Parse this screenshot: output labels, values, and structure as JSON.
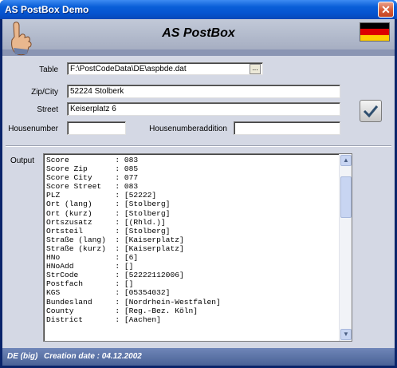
{
  "window": {
    "title": "AS PostBox Demo",
    "close_glyph": "✕"
  },
  "header": {
    "app_title": "AS PostBox",
    "flag_colors": [
      "#000000",
      "#dd0000",
      "#ffce00"
    ]
  },
  "form": {
    "table_label": "Table",
    "table_value": "F:\\PostCodeData\\DE\\aspbde.dat",
    "browse_label": "...",
    "zip_city_label": "Zip/City",
    "zip_city_value": "52224 Stolberk",
    "street_label": "Street",
    "street_value": "Keiserplatz 6",
    "housenumber_label": "Housenumber",
    "housenumber_value": "",
    "housenumberaddition_label": "Housenumberaddition",
    "housenumberaddition_value": ""
  },
  "output": {
    "label": "Output",
    "lines": [
      "Score          : 083",
      "Score Zip      : 085",
      "Score City     : 077",
      "Score Street   : 083",
      "PLZ            : [52222]",
      "Ort (lang)     : [Stolberg]",
      "Ort (kurz)     : [Stolberg]",
      "Ortszusatz     : [(Rhld.)]",
      "Ortsteil       : [Stolberg]",
      "Straße (lang)  : [Kaiserplatz]",
      "Straße (kurz)  : [Kaiserplatz]",
      "HNo            : [6]",
      "HNoAdd         : []",
      "StrCode        : [52222112006]",
      "Postfach       : []",
      "KGS            : [05354032]",
      "Bundesland     : [Nordrhein-Westfalen]",
      "County         : [Reg.-Bez. Köln]",
      "District       : [Aachen]"
    ]
  },
  "status": {
    "edition": "DE (big)",
    "creation": "Creation date : 04.12.2002"
  },
  "icons": {
    "hand": "pointing-hand-icon",
    "check": "checkmark-icon",
    "flag": "german-flag-icon"
  }
}
